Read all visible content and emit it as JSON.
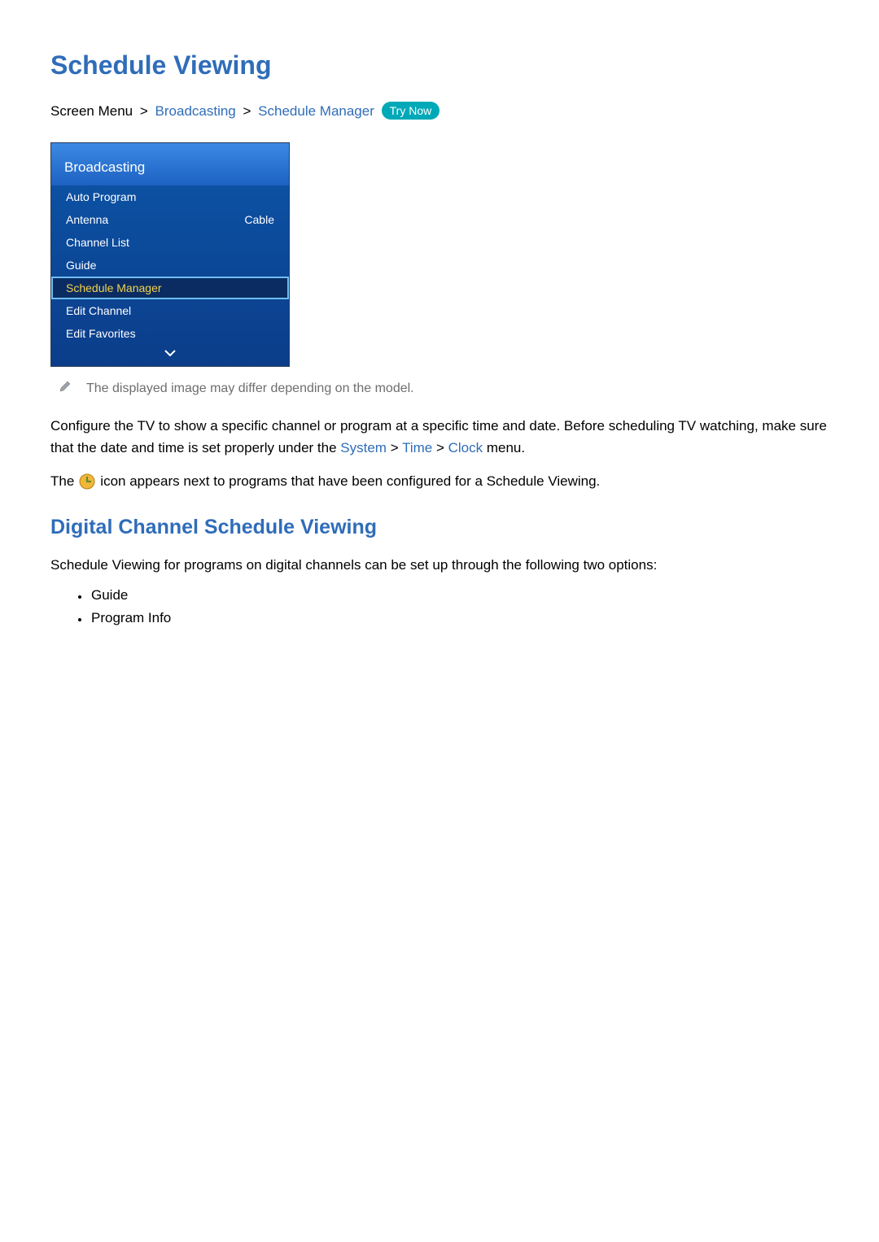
{
  "title": "Schedule Viewing",
  "breadcrumb": {
    "prefix": "Screen Menu",
    "sep": ">",
    "a": "Broadcasting",
    "b": "Schedule Manager",
    "badge": "Try Now"
  },
  "osd": {
    "header": "Broadcasting",
    "rows": [
      {
        "label": "Auto Program",
        "value": ""
      },
      {
        "label": "Antenna",
        "value": "Cable"
      },
      {
        "label": "Channel List",
        "value": ""
      },
      {
        "label": "Guide",
        "value": ""
      },
      {
        "label": "Schedule Manager",
        "value": "",
        "selected": true
      },
      {
        "label": "Edit Channel",
        "value": ""
      },
      {
        "label": "Edit Favorites",
        "value": ""
      }
    ]
  },
  "note": "The displayed image may differ depending on the model.",
  "para1_a": "Configure the TV to show a specific channel or program at a specific time and date. Before scheduling TV watching, make sure that the date and time is set properly under the ",
  "path": {
    "a": "System",
    "b": "Time",
    "c": "Clock"
  },
  "para1_b": " menu.",
  "para2_a": "The ",
  "para2_b": " icon appears next to programs that have been configured for a Schedule Viewing.",
  "subhead": "Digital Channel Schedule Viewing",
  "para3": "Schedule Viewing for programs on digital channels can be set up through the following two options:",
  "options": [
    "Guide",
    "Program Info"
  ]
}
